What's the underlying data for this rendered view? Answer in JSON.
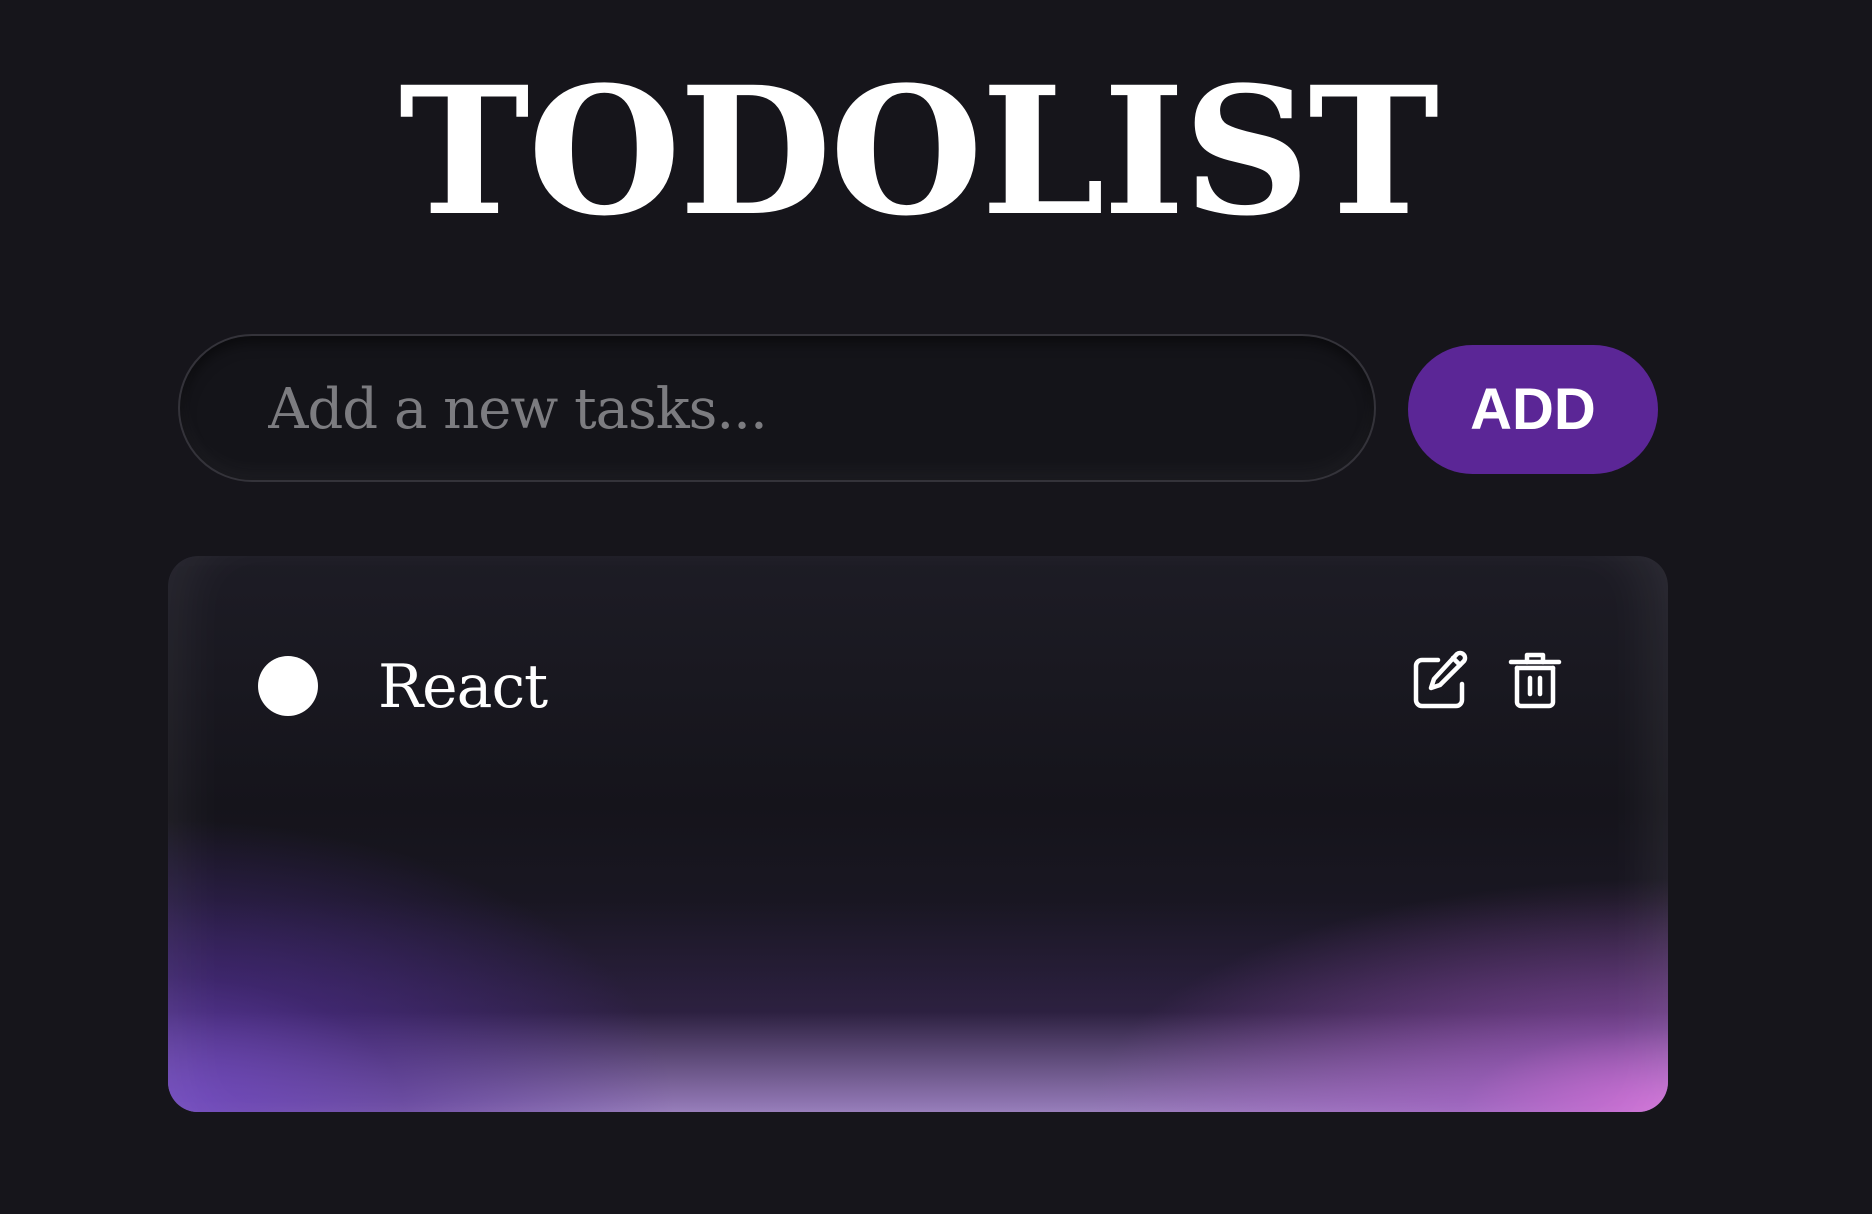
{
  "header": {
    "title": "TODOLIST"
  },
  "new_task": {
    "placeholder": "Add a new tasks...",
    "value": "",
    "add_label": "ADD"
  },
  "tasks": [
    {
      "label": "React",
      "completed": false,
      "actions": {
        "edit_icon": "edit-icon",
        "delete_icon": "trash-icon"
      }
    }
  ],
  "colors": {
    "background": "#16151b",
    "accent": "#5b2696",
    "card_gradient_left": "#6e46be",
    "card_gradient_right": "#d26ed7",
    "text": "#ffffff",
    "placeholder": "#7c7c80"
  }
}
